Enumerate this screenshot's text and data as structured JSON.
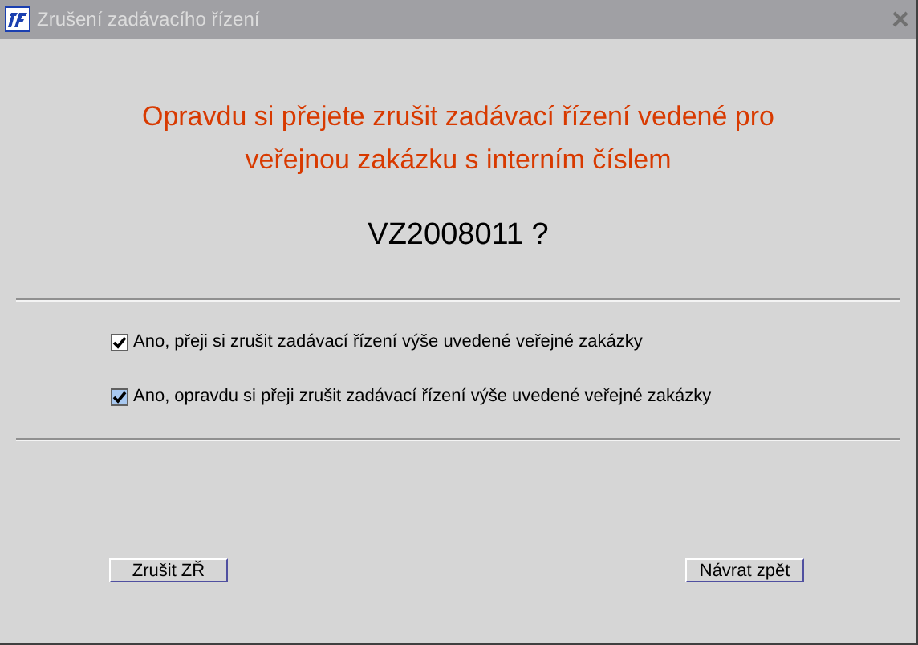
{
  "window": {
    "title": "Zrušení zadávacího řízení"
  },
  "question": "Opravdu si přejete zrušit zadávací řízení vedené pro veřejnou zakázku s interním číslem",
  "contract_number": "VZ2008011 ?",
  "checkboxes": [
    {
      "label": "Ano, přeji si zrušit zadávací řízení výše uvedené veřejné zakázky",
      "checked": true,
      "focused": false
    },
    {
      "label": "Ano, opravdu si přeji zrušit zadávací řízení výše uvedené veřejné zakázky",
      "checked": true,
      "focused": true
    }
  ],
  "buttons": [
    {
      "label": "Zrušit ZŘ"
    },
    {
      "label": "Návrat zpět"
    }
  ]
}
